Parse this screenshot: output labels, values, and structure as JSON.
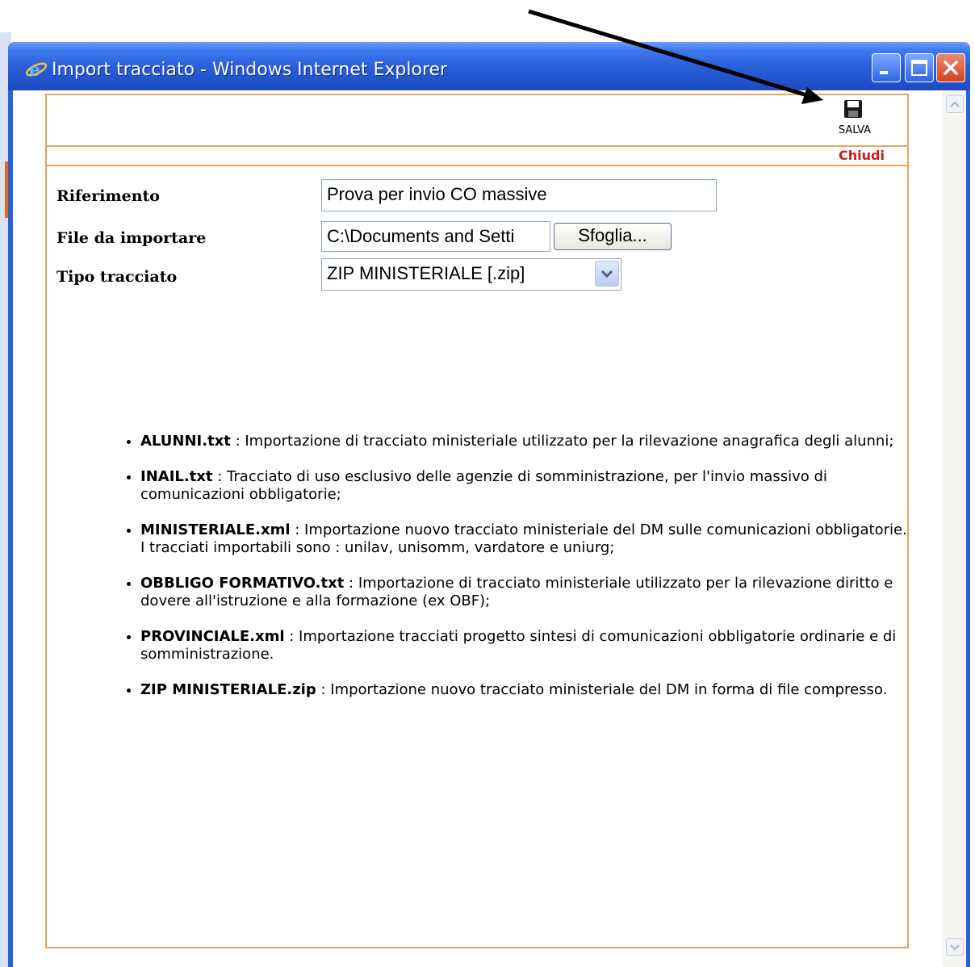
{
  "window": {
    "title": "Import tracciato - Windows Internet Explorer",
    "icon": "ie-icon",
    "controls": [
      "minimize-icon",
      "maximize-icon",
      "close-icon"
    ]
  },
  "toolbar": {
    "save_label": "SALVA",
    "save_icon": "floppy-disk-icon",
    "close_label": "Chiudi"
  },
  "form": {
    "riferimento": {
      "label": "Riferimento",
      "value": "Prova per invio CO massive"
    },
    "file": {
      "label": "File da importare",
      "value": "C:\\Documents and Setti",
      "browse_label": "Sfoglia..."
    },
    "tipo": {
      "label": "Tipo tracciato",
      "value": "ZIP MINISTERIALE [.zip]"
    }
  },
  "items": [
    {
      "name": "ALUNNI.txt",
      "text": " : Importazione di tracciato ministeriale utilizzato per la rilevazione anagrafica degli alunni;"
    },
    {
      "name": "INAIL.txt",
      "text": " : Tracciato di uso esclusivo delle agenzie di somministrazione, per l'invio massivo di comunicazioni obbligatorie;"
    },
    {
      "name": "MINISTERIALE.xml",
      "text": " : Importazione nuovo tracciato ministeriale del DM sulle comunicazioni obbligatorie.",
      "extra": "I tracciati importabili sono : unilav, unisomm, vardatore e uniurg;"
    },
    {
      "name": "OBBLIGO FORMATIVO.txt",
      "text": " : Importazione di tracciato ministeriale utilizzato per la rilevazione diritto e dovere all'istruzione e alla formazione (ex OBF);"
    },
    {
      "name": "PROVINCIALE.xml",
      "text": " : Importazione tracciati progetto sintesi di comunicazioni obbligatorie ordinarie e di somministrazione."
    },
    {
      "name": "ZIP MINISTERIALE.zip",
      "text": " : Importazione nuovo tracciato ministeriale del DM in forma di file compresso."
    }
  ],
  "colors": {
    "frame": "#e8a35c",
    "close_link": "#c81d1d",
    "titlebar": "#2a5fd9"
  }
}
